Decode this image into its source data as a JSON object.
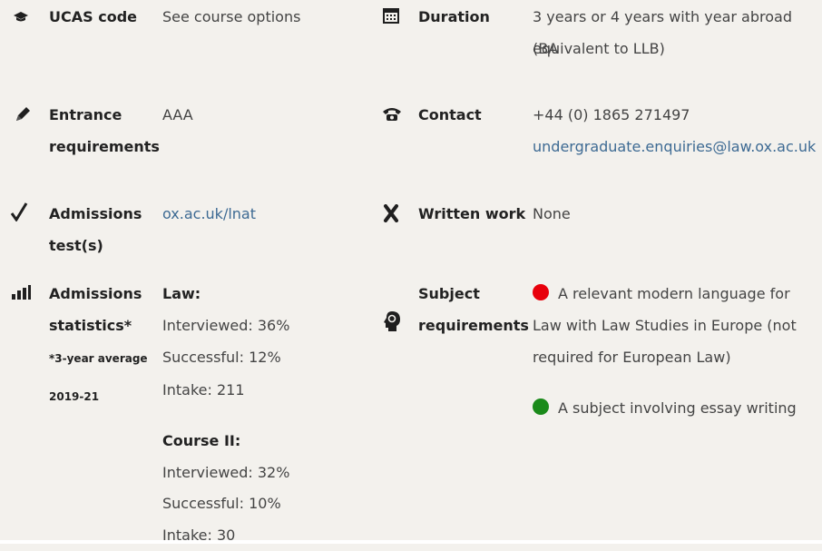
{
  "ucas": {
    "label": "UCAS code",
    "value": "See course options"
  },
  "duration": {
    "label": "Duration",
    "value_line1": "3 years or 4 years with year abroad (BA",
    "value_line2": "equivalent to LLB)"
  },
  "entrance": {
    "label_line1": "Entrance",
    "label_line2": "requirements",
    "value": "AAA"
  },
  "contact": {
    "label": "Contact",
    "phone": "+44 (0) 1865 271497",
    "email": "undergraduate.enquiries@law.ox.ac.uk"
  },
  "admissions_test": {
    "label_line1": "Admissions",
    "label_line2": "test(s)",
    "link": "ox.ac.uk/lnat"
  },
  "written_work": {
    "label": "Written work",
    "value": "None"
  },
  "admissions_stats": {
    "label_line1": "Admissions",
    "label_line2": "statistics*",
    "note_line1": "*3-year average",
    "note_line2": "2019-21",
    "law": {
      "heading": "Law:",
      "interviewed": "Interviewed: 36%",
      "successful": "Successful: 12%",
      "intake": "Intake: 211"
    },
    "course2": {
      "heading": "Course II:",
      "interviewed": "Interviewed: 32%",
      "successful": "Successful: 10%",
      "intake": "Intake: 30"
    }
  },
  "subject_req": {
    "label_line1": "Subject",
    "label_line2": "requirements",
    "item1_line1": "A relevant modern language for",
    "item1_line2": "Law with Law Studies in Europe (not",
    "item1_line3": "required for European Law)",
    "item2": "A subject involving essay writing",
    "dot1_color": "#e8000b",
    "dot2_color": "#1a8a1a"
  },
  "icons": [
    "mortarboard-icon",
    "calendar-icon",
    "pencil-icon",
    "telephone-icon",
    "checkmark-icon",
    "cross-icon",
    "bar-chart-icon",
    "brain-head-icon"
  ]
}
